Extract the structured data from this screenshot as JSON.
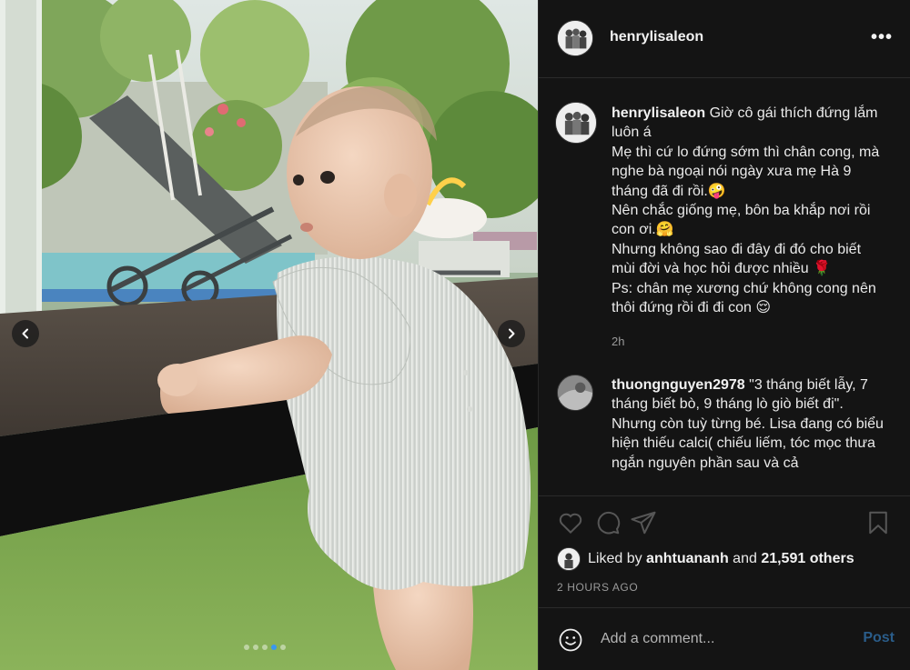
{
  "post": {
    "username": "henrylisaleon",
    "more_icon": "more-horizontal-icon",
    "more_label": "•••"
  },
  "caption": {
    "username": "henrylisaleon",
    "text": "Giờ cô gái thích đứng lắm luôn á\nMẹ thì cứ lo đứng sớm thì chân cong, mà nghe bà ngoại nói ngày xưa mẹ Hà 9 tháng đã đi rồi.🤪\nNên chắc giống mẹ, bôn ba khắp nơi rồi con ơi.🤗\nNhưng không sao đi đây đi đó cho biết mùi đời và học hỏi được nhiều 🌹\nPs: chân mẹ xương chứ không cong nên thôi đứng rồi đi đi con 😌",
    "time": "2h"
  },
  "comments": [
    {
      "username": "thuongnguyen2978",
      "text": "\"3 tháng biết lẫy, 7 tháng biết bò, 9 tháng lò giò biết đi\". Nhưng còn tuỳ từng bé. Lisa đang có biểu hiện thiếu calci( chiếu liếm, tóc mọc thưa ngắn nguyên phần sau và cả"
    }
  ],
  "likes": {
    "prefix": "Liked by ",
    "user": "anhtuananh",
    "middle": " and ",
    "count": "21,591 others"
  },
  "timestamp": "2 HOURS AGO",
  "add_comment": {
    "placeholder": "Add a comment...",
    "post_label": "Post"
  },
  "carousel": {
    "total": 5,
    "active_index": 3
  },
  "colors": {
    "panel_bg": "#141414",
    "accent_blue": "#3897f0",
    "post_disabled": "#2a5d8a"
  },
  "icons": {
    "prev": "chevron-left-icon",
    "next": "chevron-right-icon",
    "like": "heart-icon",
    "comment": "comment-icon",
    "share": "paper-plane-icon",
    "save": "bookmark-icon",
    "emoji": "smiley-icon"
  }
}
